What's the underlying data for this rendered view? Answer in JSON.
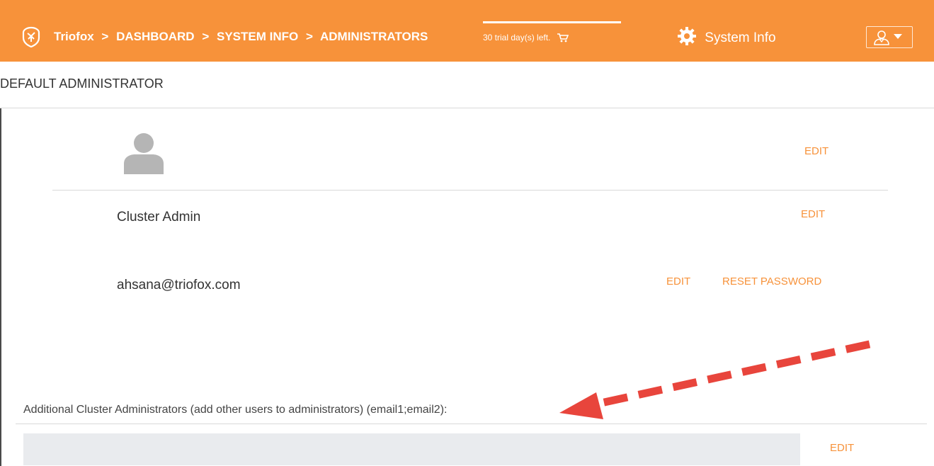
{
  "header": {
    "brand": "Triofox",
    "breadcrumb": [
      ">",
      "DASHBOARD",
      ">",
      "SYSTEM INFO",
      ">",
      "ADMINISTRATORS"
    ],
    "trial_text": "30 trial day(s) left.",
    "system_info": "System Info",
    "bg_color": "#f7923a"
  },
  "section": {
    "title": "DEFAULT ADMINISTRATOR"
  },
  "admin": {
    "name": "Cluster Admin",
    "email": "ahsana@triofox.com",
    "avatar_edit": "EDIT",
    "name_edit": "EDIT",
    "email_edit": "EDIT",
    "reset_password": "RESET PASSWORD"
  },
  "additional": {
    "label": "Additional Cluster Administrators (add other users to administrators) (email1;email2):",
    "value": "",
    "edit": "EDIT"
  },
  "colors": {
    "accent": "#f7923a",
    "arrow": "#e8453c"
  }
}
